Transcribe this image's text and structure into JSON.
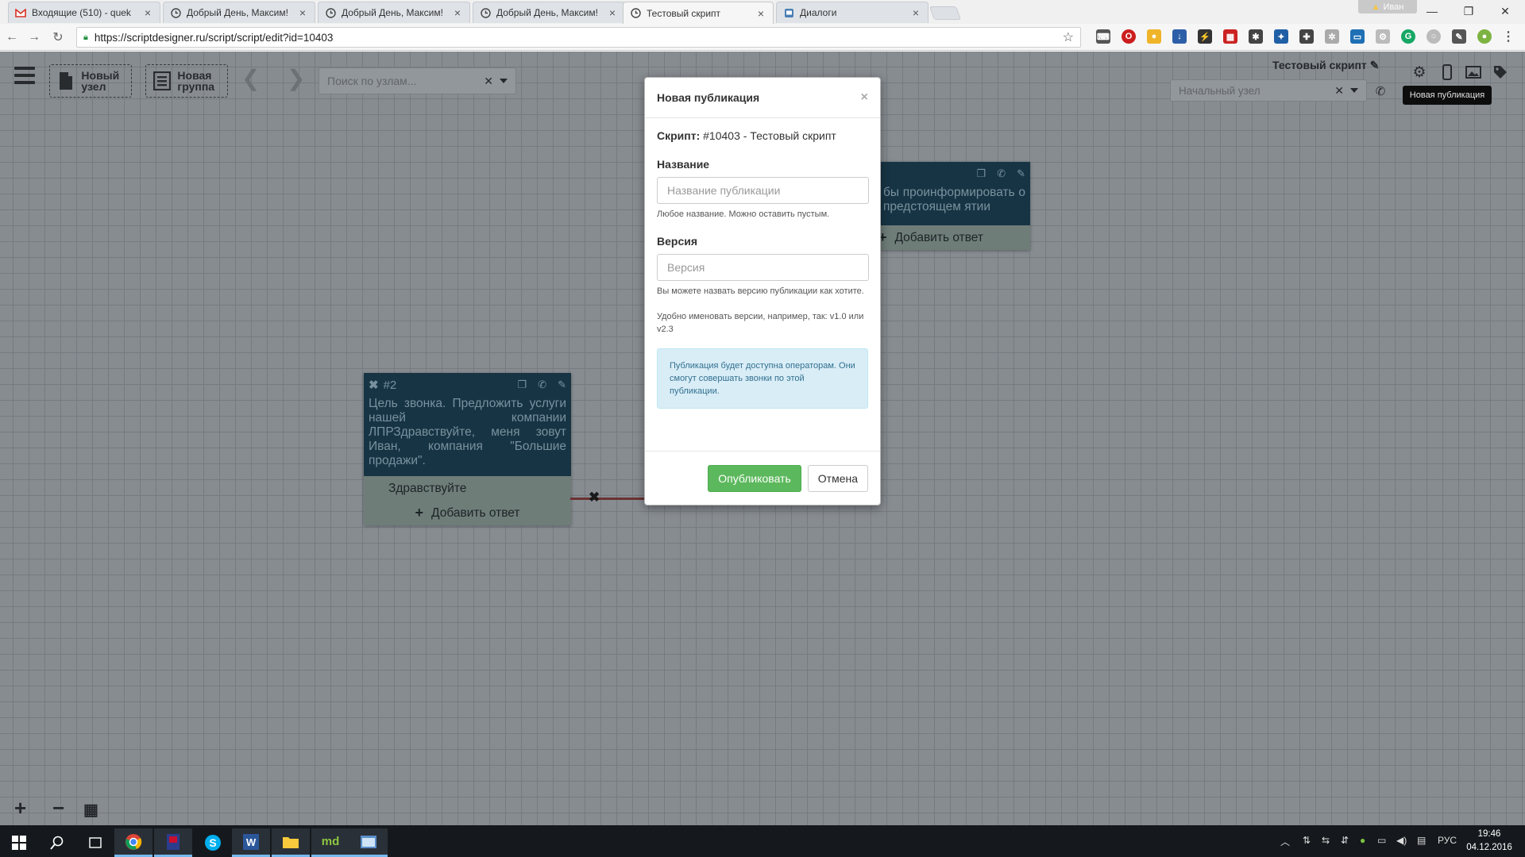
{
  "browser": {
    "tabs": [
      {
        "title": "Входящие (510) - quek",
        "icon": "gmail-icon",
        "active": false
      },
      {
        "title": "Добрый День, Максим!",
        "icon": "clock-icon",
        "active": false
      },
      {
        "title": "Добрый День, Максим!",
        "icon": "clock-icon",
        "active": false
      },
      {
        "title": "Добрый День, Максим!",
        "icon": "clock-icon",
        "active": false
      },
      {
        "title": "Тестовый скрипт",
        "icon": "clock-icon",
        "active": true
      },
      {
        "title": "Диалоги",
        "icon": "dialogs-icon",
        "active": false
      }
    ],
    "user": "Иван",
    "url": "https://scriptdesigner.ru/script/script/edit?id=10403"
  },
  "toolbar": {
    "new_node": "Новый узел",
    "new_group": "Новая группа",
    "search_placeholder": "Поиск по узлам...",
    "script_name": "Тестовый скрипт",
    "start_node_placeholder": "Начальный узел",
    "tooltip": "Новая публикация"
  },
  "nodes": {
    "node2": {
      "number": "#2",
      "text": "Цель звонка. Предложить услуги нашей компании ЛПРЗдравствуйте, меня зовут Иван, компания \"Большие продажи\".",
      "answer": "Здравствуйте",
      "add_answer": "Добавить ответ"
    },
    "node_partial": {
      "text": "бы проинформировать о предстоящем ятии",
      "add_answer": "Добавить ответ"
    }
  },
  "modal": {
    "title": "Новая публикация",
    "script_label": "Скрипт:",
    "script_value": "#10403 - Тестовый скрипт",
    "name_label": "Название",
    "name_placeholder": "Название публикации",
    "name_help": "Любое название. Можно оставить пустым.",
    "version_label": "Версия",
    "version_placeholder": "Версия",
    "version_help1": "Вы можете назвать версию публикации как хотите.",
    "version_help2": "Удобно именовать версии, например, так: v1.0 или v2.3",
    "info": "Публикация будет доступна операторам. Они смогут совершать звонки по этой публикации.",
    "publish": "Опубликовать",
    "cancel": "Отмена"
  },
  "taskbar": {
    "lang": "РУС",
    "time": "19:46",
    "date": "04.12.2016"
  },
  "colors": {
    "node_header": "#1b3c4e",
    "node_answers": "#7f8f8a",
    "publish_button": "#5cb85c",
    "info_box": "#d9edf7"
  }
}
